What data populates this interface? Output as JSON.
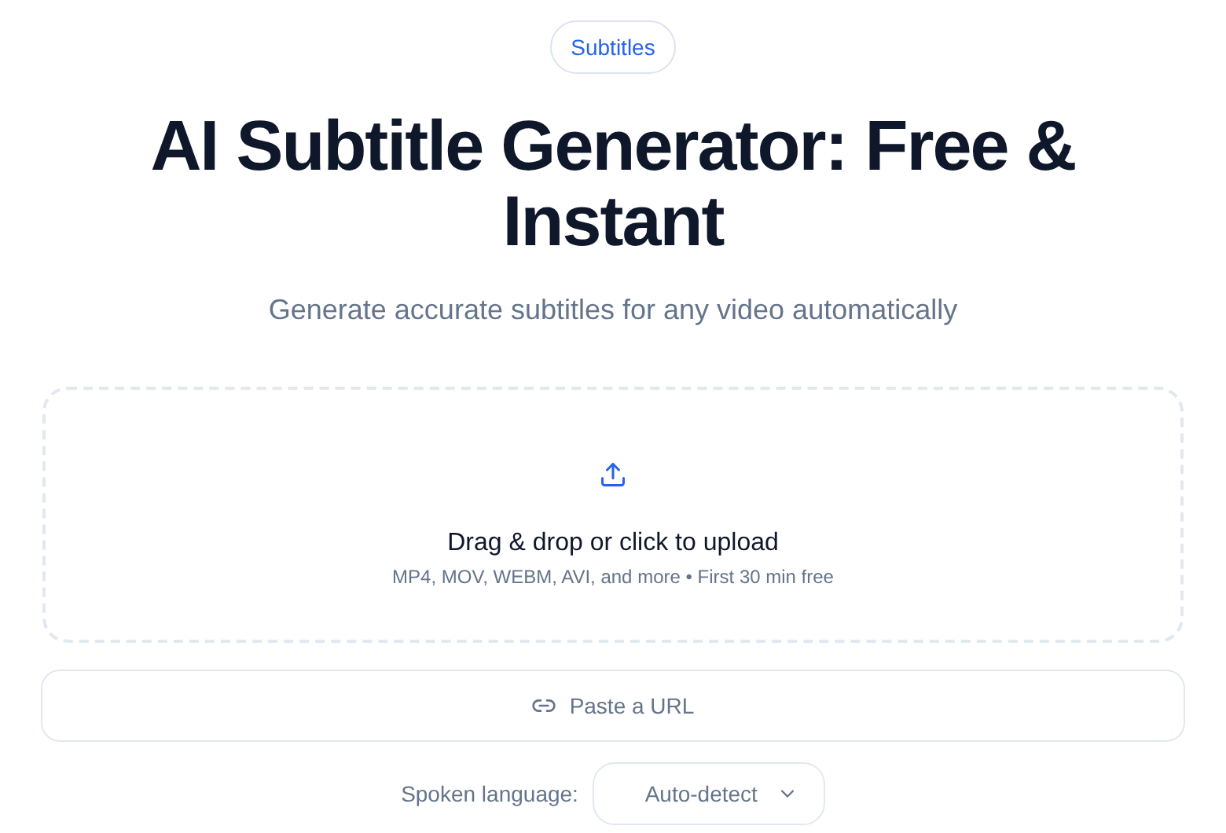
{
  "badge": "Subtitles",
  "title": "AI Subtitle Generator: Free & Instant",
  "subtitle": "Generate accurate subtitles for any video automatically",
  "upload": {
    "title": "Drag & drop or click to upload",
    "hint": "MP4, MOV, WEBM, AVI, and more • First 30 min free"
  },
  "url_button": "Paste a URL",
  "language": {
    "label": "Spoken language:",
    "value": "Auto-detect"
  }
}
